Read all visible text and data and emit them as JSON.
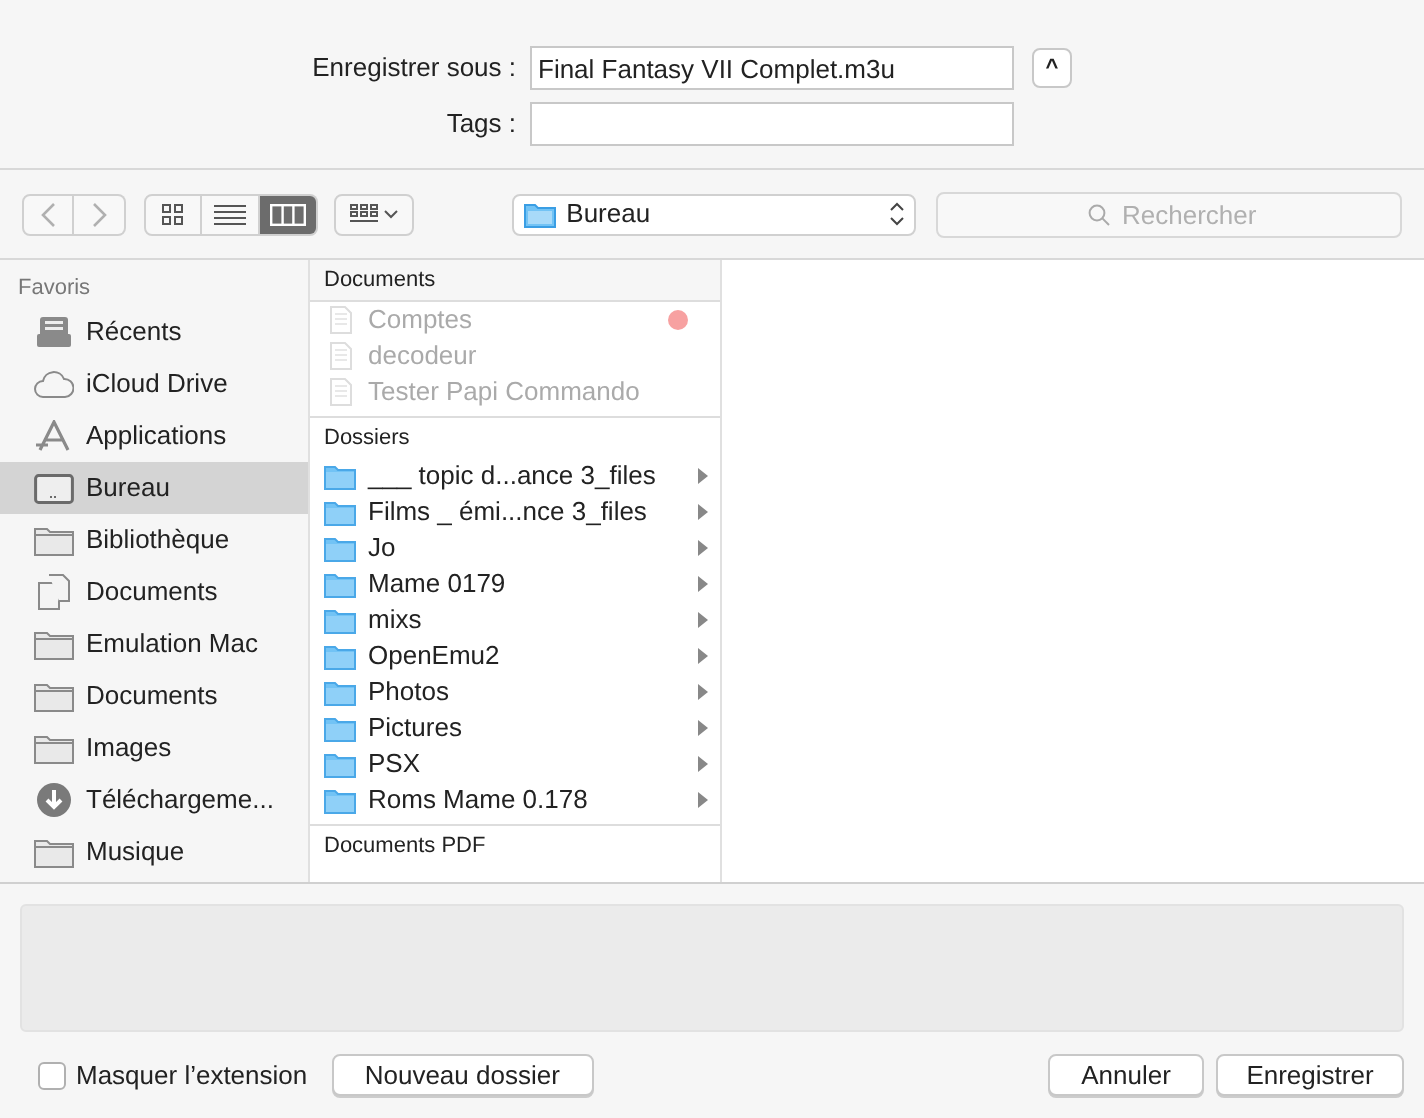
{
  "save_as": {
    "label": "Enregistrer sous :",
    "value": "Final Fantasy VII Complet.m3u",
    "expand_button": "^"
  },
  "tags": {
    "label": "Tags :"
  },
  "toolbar": {
    "views": [
      {
        "kind": "icons",
        "selected": false
      },
      {
        "kind": "list",
        "selected": false
      },
      {
        "kind": "columns",
        "selected": true
      }
    ],
    "location": "Bureau",
    "search": {
      "placeholder": "Rechercher"
    }
  },
  "sidebar": {
    "heading": "Favoris",
    "items": [
      {
        "label": "Récents",
        "kind": "recents",
        "selected": false
      },
      {
        "label": "iCloud Drive",
        "kind": "cloud",
        "selected": false
      },
      {
        "label": "Applications",
        "kind": "apps",
        "selected": false
      },
      {
        "label": "Bureau",
        "kind": "desktop",
        "selected": true
      },
      {
        "label": "Bibliothèque",
        "kind": "folder",
        "selected": false
      },
      {
        "label": "Documents",
        "kind": "document",
        "selected": false
      },
      {
        "label": "Emulation Mac",
        "kind": "folder",
        "selected": false
      },
      {
        "label": "Documents",
        "kind": "folder",
        "selected": false
      },
      {
        "label": "Images",
        "kind": "folder",
        "selected": false
      },
      {
        "label": "Téléchargeme...",
        "kind": "download",
        "selected": false
      },
      {
        "label": "Musique",
        "kind": "folder",
        "selected": false
      }
    ]
  },
  "column": {
    "sections": [
      {
        "heading": "Documents",
        "items": [
          {
            "name": "Comptes",
            "kind": "file",
            "disabled": true,
            "color": "#f7a1a1"
          },
          {
            "name": "decodeur",
            "kind": "file",
            "disabled": true
          },
          {
            "name": "Tester Papi Commando",
            "kind": "file",
            "disabled": true
          }
        ]
      },
      {
        "heading": "Dossiers",
        "items": [
          {
            "name": "___ topic d...ance 3_files",
            "kind": "folder",
            "disabled": false
          },
          {
            "name": "Films _ émi...nce 3_files",
            "kind": "folder",
            "disabled": false
          },
          {
            "name": "Jo",
            "kind": "folder",
            "disabled": false
          },
          {
            "name": "Mame 0179",
            "kind": "folder",
            "disabled": false
          },
          {
            "name": "mixs",
            "kind": "folder",
            "disabled": false
          },
          {
            "name": "OpenEmu2",
            "kind": "folder",
            "disabled": false
          },
          {
            "name": "Photos",
            "kind": "folder",
            "disabled": false
          },
          {
            "name": "Pictures",
            "kind": "folder",
            "disabled": false
          },
          {
            "name": "PSX",
            "kind": "folder",
            "disabled": false
          },
          {
            "name": "Roms Mame 0.178",
            "kind": "folder",
            "disabled": false
          }
        ]
      },
      {
        "heading": "Documents PDF"
      }
    ]
  },
  "hide_extension": {
    "label": "Masquer l’extension",
    "checked": false
  },
  "buttons": {
    "new_folder": "Nouveau dossier",
    "cancel": "Annuler",
    "save": "Enregistrer"
  }
}
